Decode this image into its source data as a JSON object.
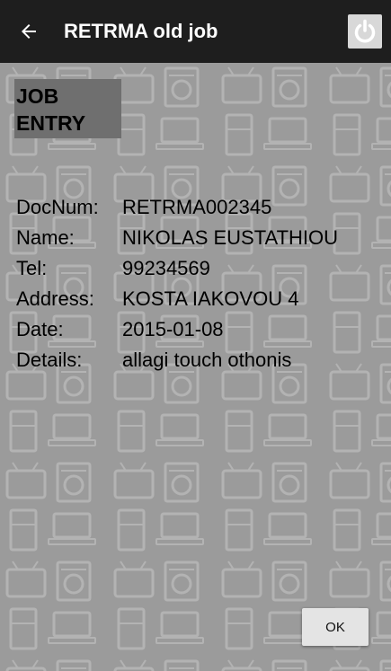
{
  "appbar": {
    "title": "RETRMA old job",
    "back_icon": "arrow-left-icon",
    "power_icon": "power-icon"
  },
  "section": {
    "heading_line1": "JOB",
    "heading_line2": "ENTRY"
  },
  "fields": [
    {
      "label": "DocNum:",
      "value": "RETRMA002345"
    },
    {
      "label": "Name:",
      "value": "NIKOLAS EUSTATHIOU"
    },
    {
      "label": "Tel:",
      "value": "99234569"
    },
    {
      "label": "Address:",
      "value": "KOSTA IAKOVOU 4"
    },
    {
      "label": "Date:",
      "value": "2015-01-08"
    },
    {
      "label": "Details:",
      "value": "allagi touch othonis"
    }
  ],
  "actions": {
    "ok_label": "OK"
  },
  "colors": {
    "appbar_bg": "#1e1e1e",
    "background": "#9b9b9b",
    "heading_bg": "#6f6f6f",
    "button_bg": "#e4e4e4"
  }
}
